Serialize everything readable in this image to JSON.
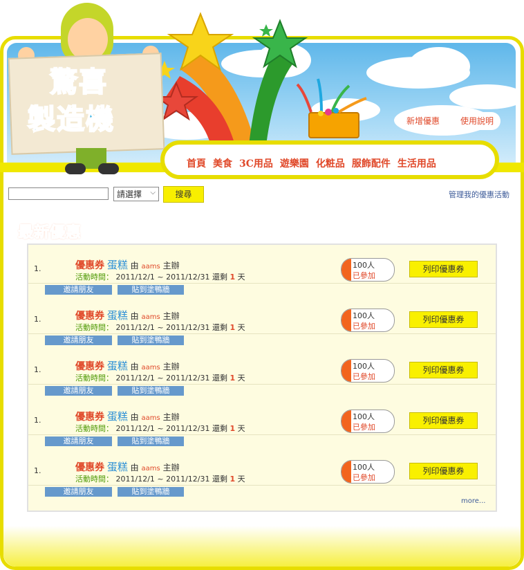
{
  "logo": {
    "line1": "驚喜",
    "line2": "製造機"
  },
  "top_buttons": {
    "add_coupon": "新增優惠",
    "help": "使用說明"
  },
  "nav": [
    "首頁",
    "美食",
    "3C用品",
    "遊樂園",
    "化粧品",
    "服飾配件",
    "生活用品"
  ],
  "search": {
    "input_value": "",
    "select_value": "請選擇",
    "button_label": "搜尋"
  },
  "manage_link": "管理我的優惠活動",
  "section_title": "最新優惠",
  "coupons": [
    {
      "num": "1.",
      "coupon_label": "優惠券",
      "item": "蛋糕",
      "by": "由",
      "host": "aams",
      "host_suffix": "主辦",
      "time_label": "活動時間：",
      "time_range": "2011/12/1 ~ 2011/12/31",
      "remain_prefix": "還剩",
      "days": "1",
      "days_suffix": "天",
      "count": "100人",
      "joined": "已參加",
      "print_label": "列印優惠券",
      "invite_label": "邀請朋友",
      "wall_label": "貼到塗鴨牆"
    },
    {
      "num": "1.",
      "coupon_label": "優惠券",
      "item": "蛋糕",
      "by": "由",
      "host": "aams",
      "host_suffix": "主辦",
      "time_label": "活動時間：",
      "time_range": "2011/12/1 ~ 2011/12/31",
      "remain_prefix": "還剩",
      "days": "1",
      "days_suffix": "天",
      "count": "100人",
      "joined": "已參加",
      "print_label": "列印優惠券",
      "invite_label": "邀請朋友",
      "wall_label": "貼到塗鴨牆"
    },
    {
      "num": "1.",
      "coupon_label": "優惠券",
      "item": "蛋糕",
      "by": "由",
      "host": "aams",
      "host_suffix": "主辦",
      "time_label": "活動時間：",
      "time_range": "2011/12/1 ~ 2011/12/31",
      "remain_prefix": "還剩",
      "days": "1",
      "days_suffix": "天",
      "count": "100人",
      "joined": "已參加",
      "print_label": "列印優惠券",
      "invite_label": "邀請朋友",
      "wall_label": "貼到塗鴨牆"
    },
    {
      "num": "1.",
      "coupon_label": "優惠券",
      "item": "蛋糕",
      "by": "由",
      "host": "aams",
      "host_suffix": "主辦",
      "time_label": "活動時間：",
      "time_range": "2011/12/1 ~ 2011/12/31",
      "remain_prefix": "還剩",
      "days": "1",
      "days_suffix": "天",
      "count": "100人",
      "joined": "已參加",
      "print_label": "列印優惠券",
      "invite_label": "邀請朋友",
      "wall_label": "貼到塗鴨牆"
    },
    {
      "num": "1.",
      "coupon_label": "優惠券",
      "item": "蛋糕",
      "by": "由",
      "host": "aams",
      "host_suffix": "主辦",
      "time_label": "活動時間：",
      "time_range": "2011/12/1 ~ 2011/12/31",
      "remain_prefix": "還剩",
      "days": "1",
      "days_suffix": "天",
      "count": "100人",
      "joined": "已參加",
      "print_label": "列印優惠券",
      "invite_label": "邀請朋友",
      "wall_label": "貼到塗鴨牆"
    }
  ],
  "more_link": "more...",
  "colors": {
    "accent_yellow": "#e7dd00",
    "title_orange": "#f15a24",
    "link_blue": "#3d5b99",
    "share_button": "#6699cc",
    "panel_bg": "#fefce0"
  }
}
